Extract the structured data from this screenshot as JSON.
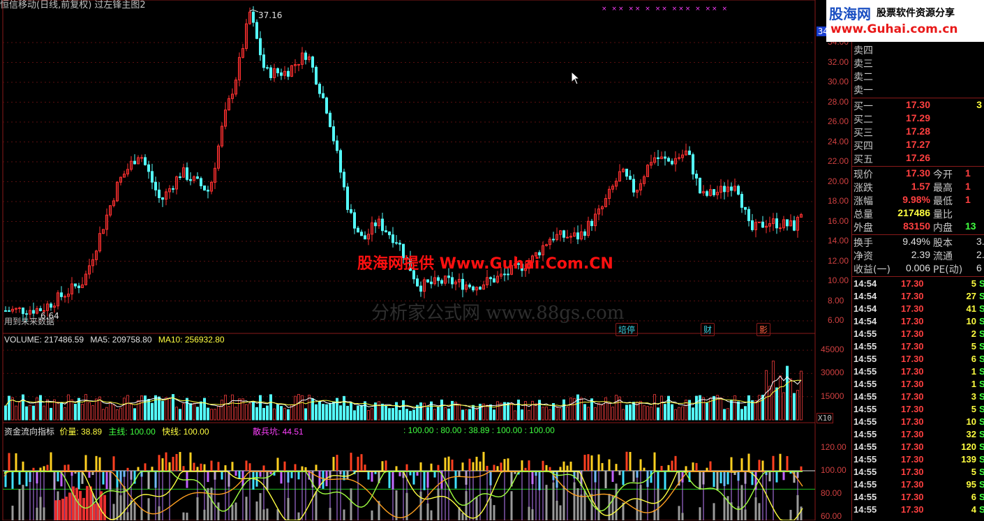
{
  "window": {
    "title": "恒信移动(日线,前复权) 过左锋主图2",
    "corner_badge": "34"
  },
  "main_chart": {
    "price_axis": [
      "34.00",
      "32.00",
      "30.00",
      "28.00",
      "26.00",
      "24.00",
      "22.00",
      "20.00",
      "18.00",
      "16.00",
      "14.00",
      "12.00",
      "10.00",
      "8.00",
      "6.00"
    ],
    "high_label": "37.16",
    "low_label": "6.64",
    "footnote": "用到未来数据",
    "tags": [
      {
        "text": "培停",
        "color": "#3ad0e0"
      },
      {
        "text": "财",
        "color": "#3ad0e0"
      },
      {
        "text": "影",
        "color": "#ff6040"
      }
    ],
    "marker_text": "× ×× ×× × ×× ××× × ×× ×"
  },
  "volume_panel": {
    "label_volume": "VOLUME: 217486.59",
    "label_ma5": "MA5: 209758.80",
    "label_ma10": "MA10: 256932.80",
    "axis": [
      "45000",
      "30000",
      "15000"
    ],
    "unit": "X10"
  },
  "indicator_panel": {
    "name": "资金流向指标",
    "price_label": "价量: 38.89",
    "main_line": "主线: 100.00",
    "fast_line": "快线: 100.00",
    "retail": "散兵坑: 44.51",
    "values_line": ": 100.00  : 80.00  : 38.89  : 100.00  : 100.00",
    "axis": [
      "120.00",
      "100.00",
      "80.00",
      "60.00"
    ]
  },
  "watermarks": {
    "red": "股海网提供 Www.Guhai.Com.CN",
    "gray": "分析家公式网 www.88gs.com"
  },
  "logo": {
    "name": "股海网",
    "slogan": "股票软件资源分享",
    "url": "www.Guhai.com.cn"
  },
  "quote": {
    "sells": [
      {
        "label": "卖四",
        "price": "",
        "vol": ""
      },
      {
        "label": "卖三",
        "price": "",
        "vol": ""
      },
      {
        "label": "卖二",
        "price": "",
        "vol": ""
      },
      {
        "label": "卖一",
        "price": "",
        "vol": ""
      }
    ],
    "buys": [
      {
        "label": "买一",
        "price": "17.30",
        "vol": "3"
      },
      {
        "label": "买二",
        "price": "17.29",
        "vol": ""
      },
      {
        "label": "买三",
        "price": "17.28",
        "vol": ""
      },
      {
        "label": "买四",
        "price": "17.27",
        "vol": ""
      },
      {
        "label": "买五",
        "price": "17.26",
        "vol": ""
      }
    ],
    "stats": [
      {
        "l1": "现价",
        "v1": "17.30",
        "l2": "今开",
        "v2": "1"
      },
      {
        "l1": "涨跌",
        "v1": "1.57",
        "l2": "最高",
        "v2": "1"
      },
      {
        "l1": "涨幅",
        "v1": "9.98%",
        "l2": "最低",
        "v2": "1"
      },
      {
        "l1": "总量",
        "v1": "217486",
        "l2": "量比",
        "v2": ""
      },
      {
        "l1": "外盘",
        "v1": "83150",
        "l2": "内盘",
        "v2": "13"
      }
    ],
    "fundamentals": [
      {
        "l1": "换手",
        "v1": "9.49%",
        "l2": "股本",
        "v2": "3."
      },
      {
        "l1": "净资",
        "v1": "2.39",
        "l2": "流通",
        "v2": "2."
      },
      {
        "l1": "收益(一)",
        "v1": "0.006",
        "l2": "PE(动)",
        "v2": "6"
      }
    ]
  },
  "ticks": [
    {
      "t": "14:54",
      "p": "17.30",
      "v": "5",
      "s": "S"
    },
    {
      "t": "14:54",
      "p": "17.30",
      "v": "27",
      "s": "S"
    },
    {
      "t": "14:54",
      "p": "17.30",
      "v": "41",
      "s": "S"
    },
    {
      "t": "14:54",
      "p": "17.30",
      "v": "10",
      "s": "S"
    },
    {
      "t": "14:55",
      "p": "17.30",
      "v": "2",
      "s": "S"
    },
    {
      "t": "14:55",
      "p": "17.30",
      "v": "5",
      "s": "S"
    },
    {
      "t": "14:55",
      "p": "17.30",
      "v": "6",
      "s": "S"
    },
    {
      "t": "14:55",
      "p": "17.30",
      "v": "1",
      "s": "S"
    },
    {
      "t": "14:55",
      "p": "17.30",
      "v": "1",
      "s": "S"
    },
    {
      "t": "14:55",
      "p": "17.30",
      "v": "3",
      "s": "S"
    },
    {
      "t": "14:55",
      "p": "17.30",
      "v": "5",
      "s": "S"
    },
    {
      "t": "14:55",
      "p": "17.30",
      "v": "10",
      "s": "S"
    },
    {
      "t": "14:55",
      "p": "17.30",
      "v": "32",
      "s": "S"
    },
    {
      "t": "14:55",
      "p": "17.30",
      "v": "120",
      "s": "S"
    },
    {
      "t": "14:55",
      "p": "17.30",
      "v": "139",
      "s": "S"
    },
    {
      "t": "14:55",
      "p": "17.30",
      "v": "5",
      "s": "S"
    },
    {
      "t": "14:55",
      "p": "17.30",
      "v": "95",
      "s": "S"
    },
    {
      "t": "14:55",
      "p": "17.30",
      "v": "6",
      "s": "S"
    },
    {
      "t": "14:55",
      "p": "17.30",
      "v": "4",
      "s": "S"
    }
  ],
  "colors": {
    "up": "#ff3030",
    "down": "#54fcfc",
    "grid": "#8a1a1a",
    "ma5": "#ffffff",
    "ma10": "#ffff40"
  }
}
